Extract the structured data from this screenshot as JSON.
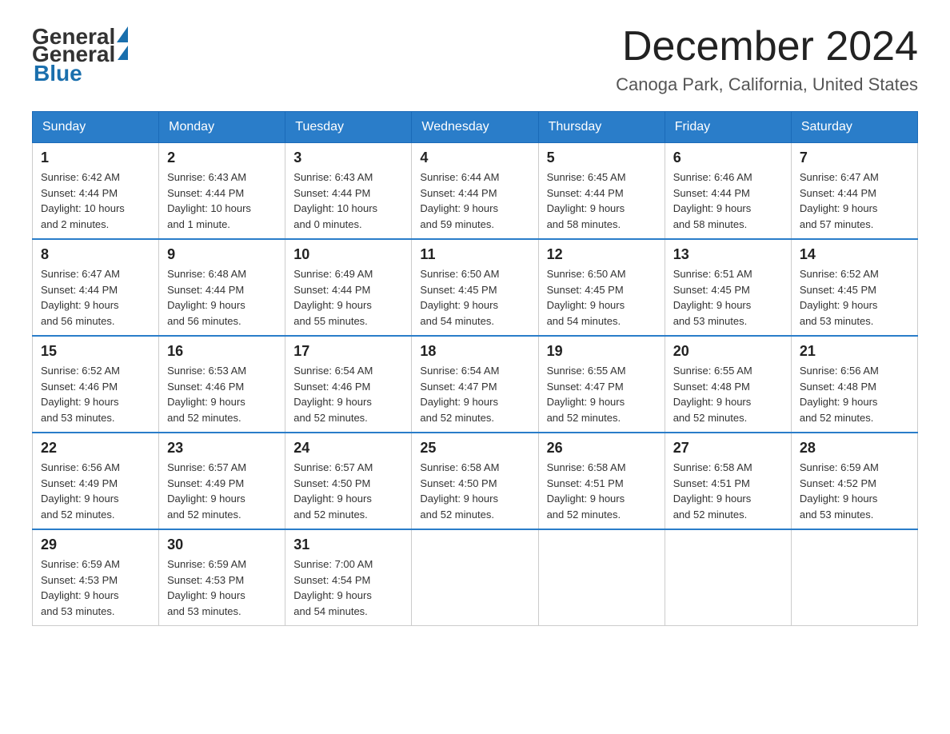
{
  "header": {
    "logo_general": "General",
    "logo_blue": "Blue",
    "month_title": "December 2024",
    "location": "Canoga Park, California, United States"
  },
  "days_of_week": [
    "Sunday",
    "Monday",
    "Tuesday",
    "Wednesday",
    "Thursday",
    "Friday",
    "Saturday"
  ],
  "weeks": [
    [
      {
        "day": "1",
        "sunrise": "6:42 AM",
        "sunset": "4:44 PM",
        "daylight": "10 hours and 2 minutes."
      },
      {
        "day": "2",
        "sunrise": "6:43 AM",
        "sunset": "4:44 PM",
        "daylight": "10 hours and 1 minute."
      },
      {
        "day": "3",
        "sunrise": "6:43 AM",
        "sunset": "4:44 PM",
        "daylight": "10 hours and 0 minutes."
      },
      {
        "day": "4",
        "sunrise": "6:44 AM",
        "sunset": "4:44 PM",
        "daylight": "9 hours and 59 minutes."
      },
      {
        "day": "5",
        "sunrise": "6:45 AM",
        "sunset": "4:44 PM",
        "daylight": "9 hours and 58 minutes."
      },
      {
        "day": "6",
        "sunrise": "6:46 AM",
        "sunset": "4:44 PM",
        "daylight": "9 hours and 58 minutes."
      },
      {
        "day": "7",
        "sunrise": "6:47 AM",
        "sunset": "4:44 PM",
        "daylight": "9 hours and 57 minutes."
      }
    ],
    [
      {
        "day": "8",
        "sunrise": "6:47 AM",
        "sunset": "4:44 PM",
        "daylight": "9 hours and 56 minutes."
      },
      {
        "day": "9",
        "sunrise": "6:48 AM",
        "sunset": "4:44 PM",
        "daylight": "9 hours and 56 minutes."
      },
      {
        "day": "10",
        "sunrise": "6:49 AM",
        "sunset": "4:44 PM",
        "daylight": "9 hours and 55 minutes."
      },
      {
        "day": "11",
        "sunrise": "6:50 AM",
        "sunset": "4:45 PM",
        "daylight": "9 hours and 54 minutes."
      },
      {
        "day": "12",
        "sunrise": "6:50 AM",
        "sunset": "4:45 PM",
        "daylight": "9 hours and 54 minutes."
      },
      {
        "day": "13",
        "sunrise": "6:51 AM",
        "sunset": "4:45 PM",
        "daylight": "9 hours and 53 minutes."
      },
      {
        "day": "14",
        "sunrise": "6:52 AM",
        "sunset": "4:45 PM",
        "daylight": "9 hours and 53 minutes."
      }
    ],
    [
      {
        "day": "15",
        "sunrise": "6:52 AM",
        "sunset": "4:46 PM",
        "daylight": "9 hours and 53 minutes."
      },
      {
        "day": "16",
        "sunrise": "6:53 AM",
        "sunset": "4:46 PM",
        "daylight": "9 hours and 52 minutes."
      },
      {
        "day": "17",
        "sunrise": "6:54 AM",
        "sunset": "4:46 PM",
        "daylight": "9 hours and 52 minutes."
      },
      {
        "day": "18",
        "sunrise": "6:54 AM",
        "sunset": "4:47 PM",
        "daylight": "9 hours and 52 minutes."
      },
      {
        "day": "19",
        "sunrise": "6:55 AM",
        "sunset": "4:47 PM",
        "daylight": "9 hours and 52 minutes."
      },
      {
        "day": "20",
        "sunrise": "6:55 AM",
        "sunset": "4:48 PM",
        "daylight": "9 hours and 52 minutes."
      },
      {
        "day": "21",
        "sunrise": "6:56 AM",
        "sunset": "4:48 PM",
        "daylight": "9 hours and 52 minutes."
      }
    ],
    [
      {
        "day": "22",
        "sunrise": "6:56 AM",
        "sunset": "4:49 PM",
        "daylight": "9 hours and 52 minutes."
      },
      {
        "day": "23",
        "sunrise": "6:57 AM",
        "sunset": "4:49 PM",
        "daylight": "9 hours and 52 minutes."
      },
      {
        "day": "24",
        "sunrise": "6:57 AM",
        "sunset": "4:50 PM",
        "daylight": "9 hours and 52 minutes."
      },
      {
        "day": "25",
        "sunrise": "6:58 AM",
        "sunset": "4:50 PM",
        "daylight": "9 hours and 52 minutes."
      },
      {
        "day": "26",
        "sunrise": "6:58 AM",
        "sunset": "4:51 PM",
        "daylight": "9 hours and 52 minutes."
      },
      {
        "day": "27",
        "sunrise": "6:58 AM",
        "sunset": "4:51 PM",
        "daylight": "9 hours and 52 minutes."
      },
      {
        "day": "28",
        "sunrise": "6:59 AM",
        "sunset": "4:52 PM",
        "daylight": "9 hours and 53 minutes."
      }
    ],
    [
      {
        "day": "29",
        "sunrise": "6:59 AM",
        "sunset": "4:53 PM",
        "daylight": "9 hours and 53 minutes."
      },
      {
        "day": "30",
        "sunrise": "6:59 AM",
        "sunset": "4:53 PM",
        "daylight": "9 hours and 53 minutes."
      },
      {
        "day": "31",
        "sunrise": "7:00 AM",
        "sunset": "4:54 PM",
        "daylight": "9 hours and 54 minutes."
      },
      null,
      null,
      null,
      null
    ]
  ],
  "labels": {
    "sunrise": "Sunrise:",
    "sunset": "Sunset:",
    "daylight": "Daylight:"
  }
}
